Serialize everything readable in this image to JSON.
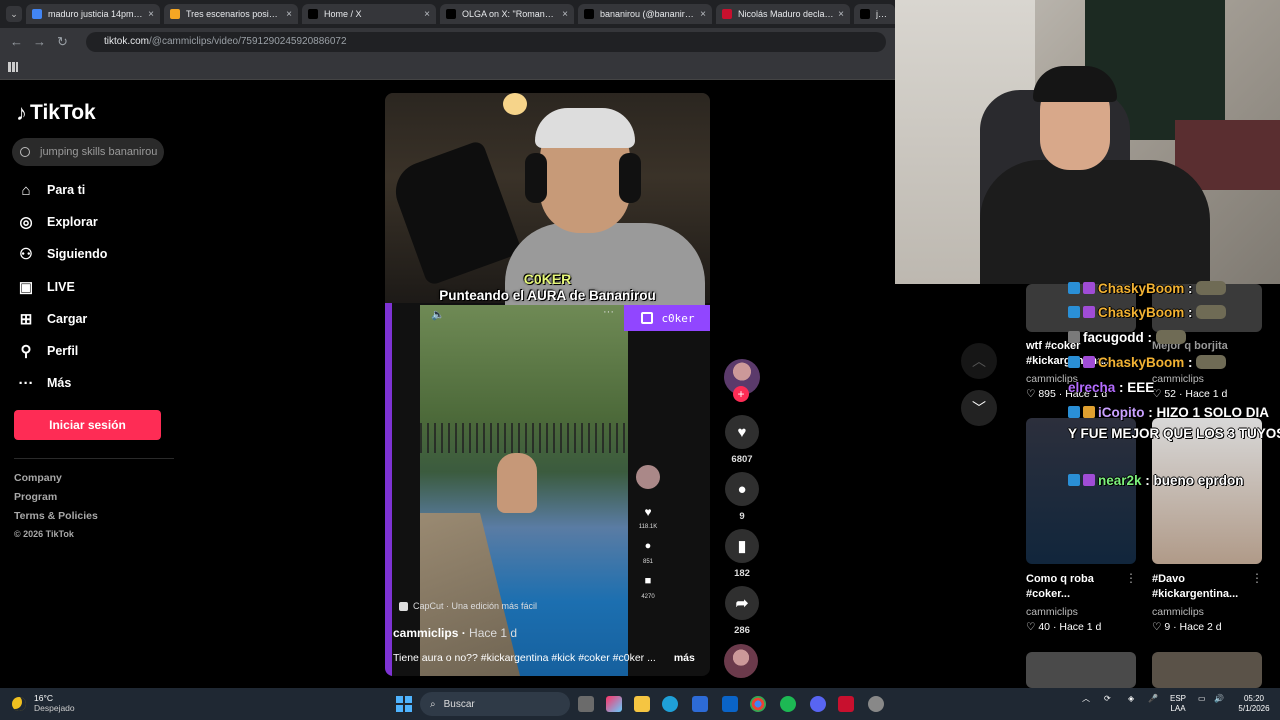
{
  "browser": {
    "tabs": [
      {
        "label": "maduro justicia 14pm - B",
        "color": "#4285f4"
      },
      {
        "label": "Tres escenarios posibles p",
        "color": "#f5a623"
      },
      {
        "label": "Home / X",
        "color": "#000000"
      },
      {
        "label": "OLGA on X: \"Romance en",
        "color": "#000000"
      },
      {
        "label": "bananirou (@bananirouxc",
        "color": "#000000"
      },
      {
        "label": "Nicolás Maduro declara c",
        "color": "#c8102e"
      },
      {
        "label": "jump",
        "color": "#000000"
      }
    ],
    "url_domain": "tiktok.com",
    "url_path": "/@cammiclips/video/7591290245920886072"
  },
  "tiktok": {
    "logo": "TikTok",
    "search_placeholder": "jumping skills bananirou",
    "nav": [
      {
        "label": "Para ti",
        "icon": "home-icon"
      },
      {
        "label": "Explorar",
        "icon": "compass-icon"
      },
      {
        "label": "Siguiendo",
        "icon": "following-icon"
      },
      {
        "label": "LIVE",
        "icon": "live-icon"
      },
      {
        "label": "Cargar",
        "icon": "upload-icon"
      },
      {
        "label": "Perfil",
        "icon": "profile-icon"
      },
      {
        "label": "Más",
        "icon": "more-icon"
      }
    ],
    "login_label": "Iniciar sesión",
    "footer": [
      "Company",
      "Program",
      "Terms & Policies"
    ],
    "copyright": "© 2026 TikTok"
  },
  "video": {
    "caption_name": "C0KER",
    "caption_title": "Punteando el AURA de Bananirou",
    "twitch_user": "c0ker",
    "inner_likes": "118.1K",
    "inner_comments": "851",
    "inner_saves": "4270",
    "capcut_label": "CapCut · Una edición más fácil",
    "author": "cammiclips",
    "posted": "Hace 1 d",
    "description": "Tiene aura o no?? #kickargentina #kick #coker #c0ker ...",
    "more_label": "más",
    "likes": "6807",
    "comments": "9",
    "saves": "182",
    "shares": "286"
  },
  "feed": [
    {
      "title": "wtf #coker #kickargentina...",
      "author": "cammiclips",
      "likes": "895",
      "age": "Hace 1 d"
    },
    {
      "title": "Mejor q borjita",
      "author": "cammiclips",
      "likes": "52",
      "age": "Hace 1 d"
    },
    {
      "title": "Como q roba #coker...",
      "author": "cammiclips",
      "likes": "40",
      "age": "Hace 1 d"
    },
    {
      "title": "#Davo #kickargentina...",
      "author": "cammiclips",
      "likes": "9",
      "age": "Hace 2 d"
    }
  ],
  "chat": [
    {
      "user": "ChaskyBoom",
      "msg": "",
      "color": "#f2b233"
    },
    {
      "user": "ChaskyBoom",
      "msg": "",
      "color": "#f2b233"
    },
    {
      "user": "facugodd",
      "msg": "",
      "color": "#ffffff"
    },
    {
      "user": "ChaskyBoom",
      "msg": "",
      "color": "#f2b233"
    },
    {
      "user": "elrecha",
      "msg": "EEE",
      "color": "#b46cff"
    },
    {
      "user": "iCopito",
      "msg": "HIZO 1 SOLO DIA",
      "color": "#c9a0ff"
    },
    {
      "user": "",
      "msg": "Y FUE MEJOR QUE LOS 3 TUYOS",
      "color": "#ffffff"
    },
    {
      "user": "near2k",
      "msg": "bueno eprdon",
      "color": "#7cf07c"
    }
  ],
  "taskbar": {
    "temp": "16°C",
    "weather": "Despejado",
    "search_label": "Buscar",
    "lang1": "ESP",
    "lang2": "LAA",
    "time": "05:20",
    "date": "5/1/2026"
  }
}
